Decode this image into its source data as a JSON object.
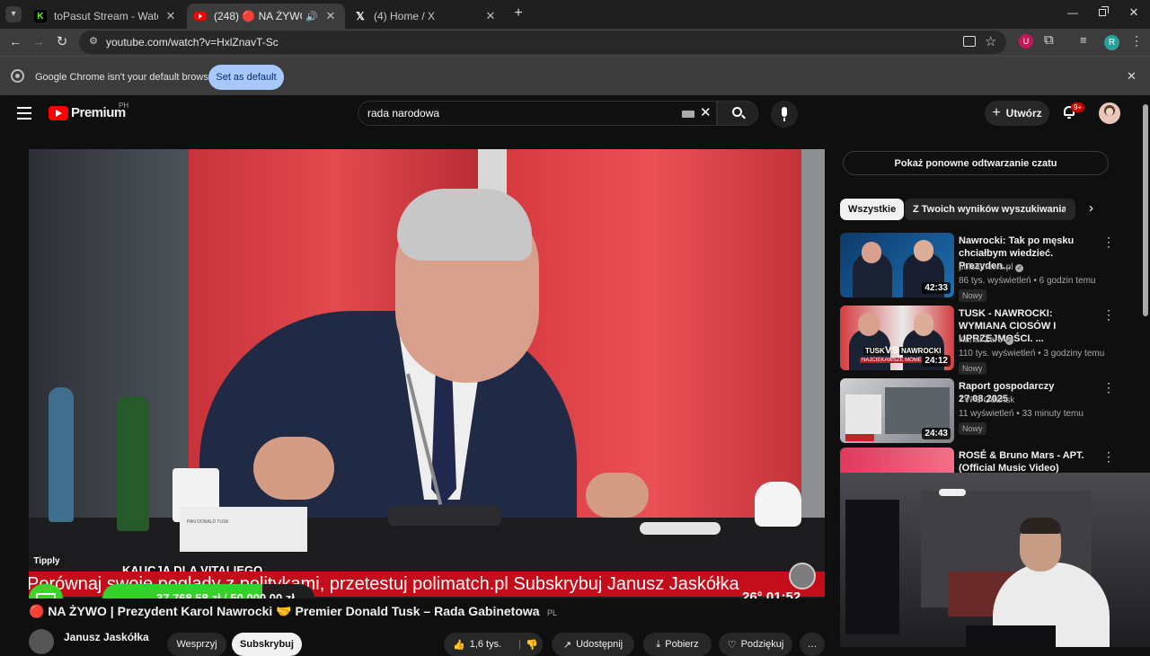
{
  "browser": {
    "tabs": [
      {
        "title": "toPasut Stream - Watch Live on",
        "favicon_letter": "K",
        "favicon_color": "#53fc18"
      },
      {
        "title": "(248) 🔴 NA ŻYWO | Prezyd",
        "favicon_color": "#ff0000",
        "active": true
      },
      {
        "title": "(4) Home / X",
        "favicon_letter": "𝕏"
      }
    ],
    "new_tab": "+",
    "url": "youtube.com/watch?v=HxlZnavT-Sc",
    "profile_initial": "R",
    "infobar": {
      "message": "Google Chrome isn't your default browser",
      "button": "Set as default"
    }
  },
  "youtube": {
    "logo": "Premium",
    "region": "PH",
    "search_value": "rada narodowa",
    "create_label": "Utwórz",
    "notifications": "9+",
    "chat_replay": "Pokaż ponowne odtwarzanie czatu",
    "chips": [
      "Wszystkie",
      "Z Twoich wyników wyszukiwania"
    ],
    "video": {
      "tipply": "Tipply",
      "goal_title": "KAUCJA DLA VITALIEGO",
      "goal_amount": "37 768,58 zł / 50 000,00 zł",
      "goal_progress": 0.755,
      "ticker": "Porównaj swoje poglądy z politykami, przetestuj polimatch.pl Subskrybuj Janusz Jaskółka",
      "weather": "26° 01:52",
      "nameplate": "PAN DONALD TUSK"
    },
    "title": "🔴 NA ŻYWO | Prezydent Karol Nawrocki 🤝 Premier Donald Tusk – Rada Gabinetowa",
    "title_badge": "PL",
    "channel": "Janusz Jaskółka",
    "actions": {
      "support": "Wesprzyj",
      "subscribe": "Subskrybuj",
      "likes": "1,6 tys.",
      "share": "Udostępnij",
      "download": "Pobierz",
      "thanks": "Podziękuj",
      "more": "…"
    },
    "recommendations": [
      {
        "title": "Nawrocki: Tak po męsku chciałbym wiedzieć. Prezyden...",
        "channel": "polsatnews.pl",
        "verified": true,
        "meta": "86 tys. wyświetleń • 6 godzin temu",
        "badge": "Nowy",
        "duration": "42:33"
      },
      {
        "title": "TUSK - NAWROCKI: WYMIANA CIOSÓW I UPRZEJMOŚCI. ...",
        "channel": "Kanał Zero",
        "verified": true,
        "meta": "110 tys. wyświetleń • 3 godziny temu",
        "badge": "Nowy",
        "duration": "24:12",
        "thumb_text": [
          "TUSK",
          "VS",
          "NAWROCKI",
          "NAJCIEKAWSZE MOME"
        ]
      },
      {
        "title": "Raport gospodarczy 27.08.2025",
        "channel": "TVP3 Gdańsk",
        "verified": false,
        "meta": "11 wyświetleń • 33 minuty temu",
        "badge": "Nowy",
        "duration": "24:43"
      },
      {
        "title": "ROSÉ & Bruno Mars - APT. (Official Music Video)",
        "channel": "",
        "meta": "",
        "badge": "",
        "duration": ""
      }
    ]
  }
}
